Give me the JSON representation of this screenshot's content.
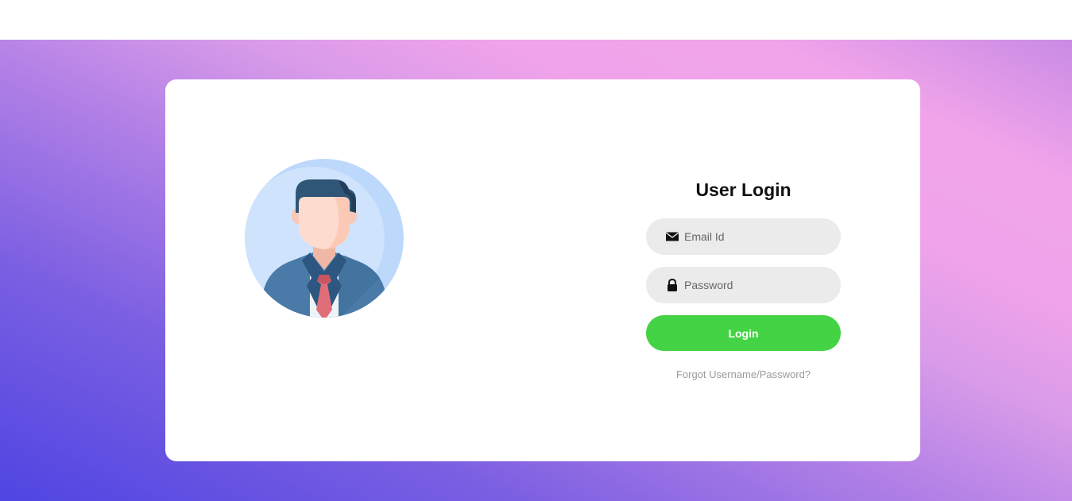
{
  "login": {
    "title": "User Login",
    "email_placeholder": "Email Id",
    "password_placeholder": "Password",
    "login_label": "Login",
    "forgot_link": "Forgot Username/Password?"
  },
  "icons": {
    "avatar": "user-avatar-icon",
    "email": "envelope-icon",
    "password": "lock-icon"
  },
  "colors": {
    "gradient_start": "#4f45e2",
    "gradient_end": "#f0a3ea",
    "card": "#ffffff",
    "input_bg": "#ebebeb",
    "button": "#44d344",
    "link": "#9a9a9a"
  }
}
